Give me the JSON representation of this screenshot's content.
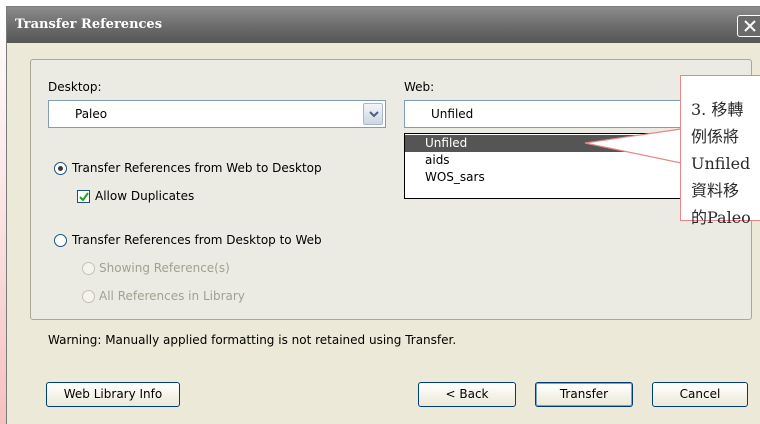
{
  "dialog": {
    "title": "Transfer References"
  },
  "desktop": {
    "label": "Desktop:",
    "value": "Paleo"
  },
  "web": {
    "label": "Web:",
    "value": "Unfiled",
    "options": [
      "Unfiled",
      "aids",
      "WOS_sars"
    ]
  },
  "options": {
    "web_to_desktop": "Transfer References from Web to Desktop",
    "allow_duplicates": "Allow Duplicates",
    "desktop_to_web": "Transfer References from Desktop to Web",
    "showing_refs": "Showing Reference(s)",
    "all_refs": "All References in Library"
  },
  "warning": "Warning: Manually applied formatting is not retained using Transfer.",
  "buttons": {
    "web_library_info": "Web Library Info",
    "back": "< Back",
    "transfer": "Transfer",
    "cancel": "Cancel"
  },
  "callout": {
    "lines": [
      "3. 移轉",
      "例係將",
      "Unfiled",
      "資料移",
      "的Paleo"
    ]
  },
  "colors": {
    "titlebar": "#6b6b6b",
    "selection": "#555555",
    "callout_border": "#e88787"
  }
}
